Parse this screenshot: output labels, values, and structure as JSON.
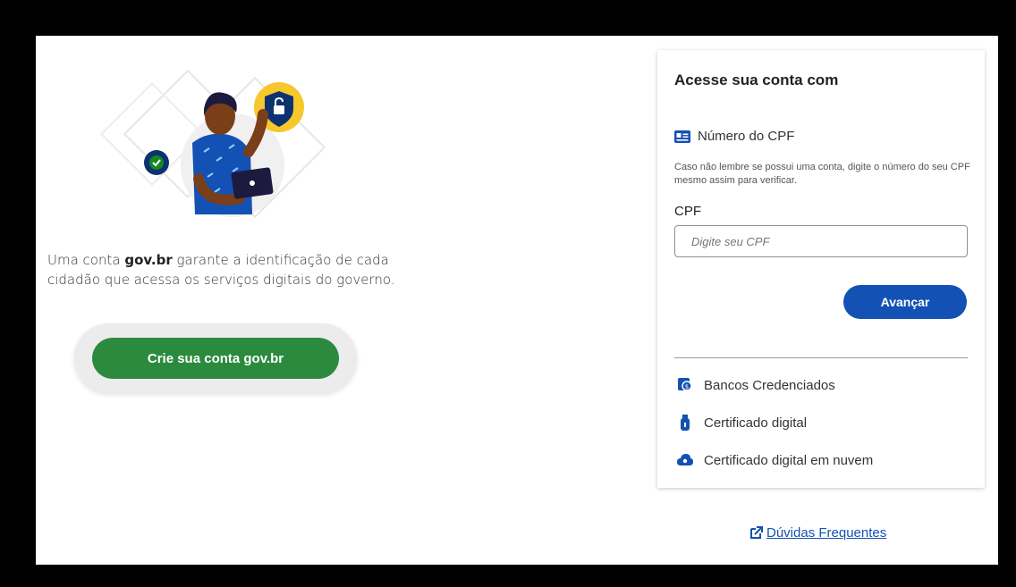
{
  "intro": {
    "prefix": "Uma conta ",
    "brand": "gov.br",
    "rest": " garante a identificação de cada cidadão que acessa os serviços digitais do governo."
  },
  "create_button": "Crie sua conta gov.br",
  "card": {
    "title": "Acesse sua conta com",
    "cpf_option": "Número do CPF",
    "hint": "Caso não lembre se possui uma conta, digite o número do seu CPF mesmo assim para verificar.",
    "cpf_label": "CPF",
    "cpf_placeholder": "Digite seu CPF",
    "cpf_value": "",
    "next_button": "Avançar",
    "alternatives": [
      {
        "label": "Bancos Credenciados",
        "icon": "bank-icon"
      },
      {
        "label": "Certificado digital",
        "icon": "usb-token-icon"
      },
      {
        "label": "Certificado digital em nuvem",
        "icon": "cloud-certificate-icon"
      }
    ]
  },
  "faq_link": "Dúvidas Frequentes",
  "colors": {
    "green": "#2b8a3e",
    "blue": "#1351b4",
    "yellow": "#f7c82c",
    "navy": "#0c326f"
  }
}
